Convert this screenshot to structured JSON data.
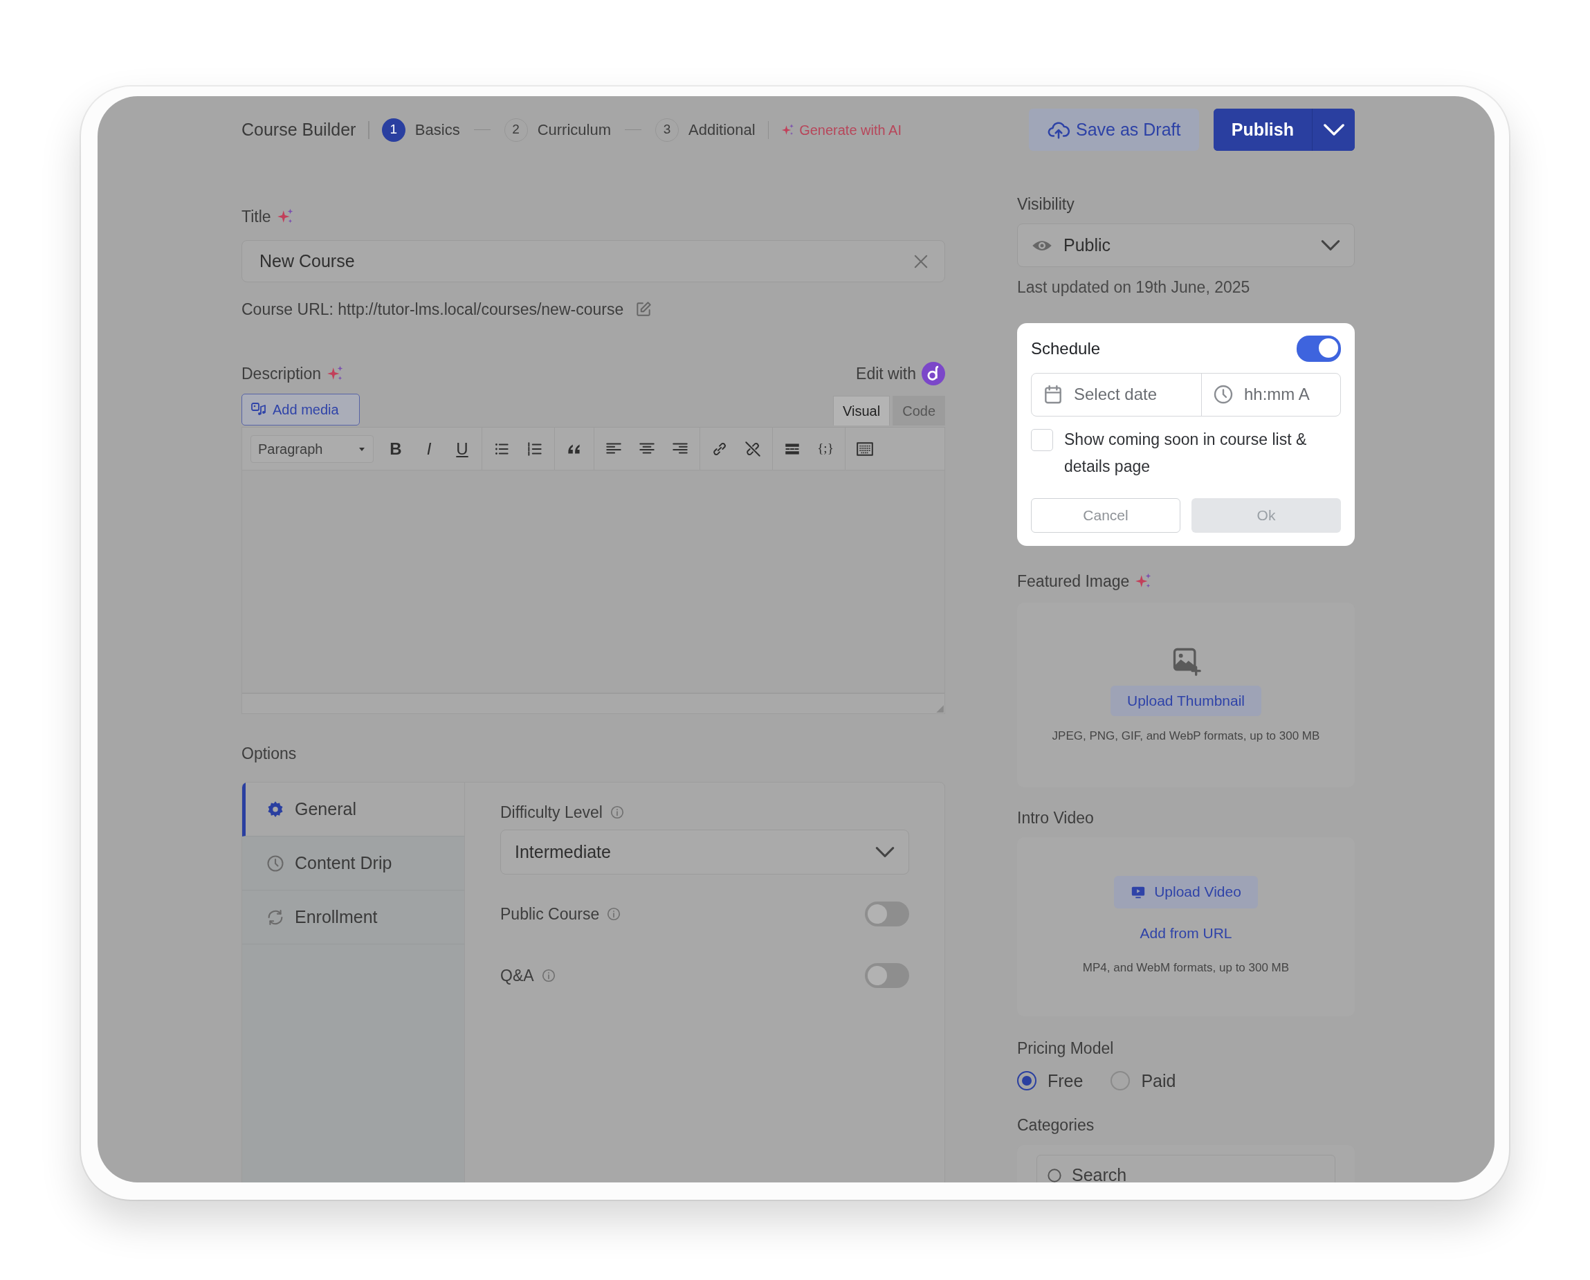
{
  "header": {
    "title": "Course Builder",
    "steps": [
      {
        "number": "1",
        "label": "Basics",
        "selected": true
      },
      {
        "number": "2",
        "label": "Curriculum",
        "selected": false
      },
      {
        "number": "3",
        "label": "Additional",
        "selected": false
      }
    ],
    "ai_link": "Generate with AI",
    "save_draft": "Save as Draft",
    "publish": "Publish"
  },
  "title_field": {
    "label": "Title",
    "value": "New Course"
  },
  "course_url": "Course URL: http://tutor-lms.local/courses/new-course",
  "description": {
    "label": "Description",
    "edit_with": "Edit with",
    "add_media": "Add media",
    "editor_tabs": [
      {
        "label": "Visual",
        "selected": true
      },
      {
        "label": "Code",
        "selected": false
      }
    ],
    "format": "Paragraph",
    "format_buttons": [
      {
        "kind": "bold",
        "glyph": "B"
      },
      {
        "kind": "italic",
        "glyph": "I"
      },
      {
        "kind": "underline",
        "glyph": "U"
      }
    ],
    "code_glyph": "{;}"
  },
  "options": {
    "label": "Options",
    "tabs": [
      {
        "kind": "gear",
        "label": "General",
        "selected": true
      },
      {
        "kind": "clock",
        "label": "Content Drip",
        "selected": false
      },
      {
        "kind": "refresh",
        "label": "Enrollment",
        "selected": false
      }
    ],
    "difficulty": {
      "label": "Difficulty Level",
      "value": "Intermediate"
    },
    "toggles": [
      {
        "label": "Public Course",
        "on": false
      },
      {
        "label": "Q&A",
        "on": false
      }
    ]
  },
  "visibility": {
    "label": "Visibility",
    "value": "Public",
    "updated": "Last updated on 19th June, 2025"
  },
  "schedule": {
    "title": "Schedule",
    "on": true,
    "date_placeholder": "Select date",
    "time_placeholder": "hh:mm A",
    "coming_soon": {
      "label": "Show coming soon in course list & details page",
      "checked": false
    },
    "cancel": "Cancel",
    "ok": {
      "label": "Ok",
      "disabled": true
    }
  },
  "featured_image": {
    "label": "Featured Image",
    "button": "Upload Thumbnail",
    "note": "JPEG, PNG, GIF, and WebP formats, up to 300 MB"
  },
  "intro_video": {
    "label": "Intro Video",
    "button": "Upload Video",
    "link": "Add from URL",
    "note": "MP4, and WebM formats, up to 300 MB"
  },
  "pricing": {
    "label": "Pricing Model",
    "options": [
      {
        "label": "Free",
        "selected": true
      },
      {
        "label": "Paid",
        "selected": false
      }
    ]
  },
  "categories": {
    "label": "Categories",
    "search_placeholder": "Search"
  }
}
